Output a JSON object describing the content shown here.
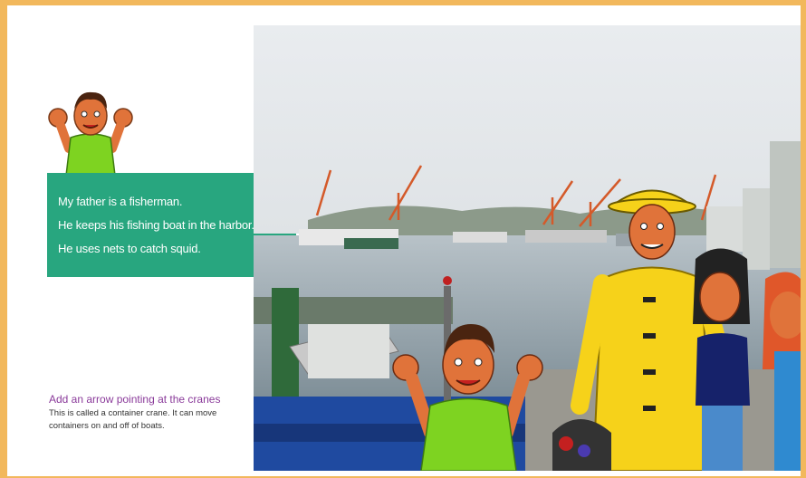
{
  "story": {
    "lines": [
      "My father is a fisherman.",
      "He keeps his fishing boat in the harbor.",
      "He uses nets to catch squid."
    ]
  },
  "note": {
    "title": "Add an arrow pointing at the cranes",
    "body": "This is called a container crane. It can move containers on and off of boats."
  },
  "colors": {
    "frame": "#f2b85c",
    "textbox": "#28a67f",
    "note_title": "#8a3a9a",
    "raincoat": "#f6d21a",
    "shirt_green": "#7ed321",
    "skin": "#e0733a"
  }
}
